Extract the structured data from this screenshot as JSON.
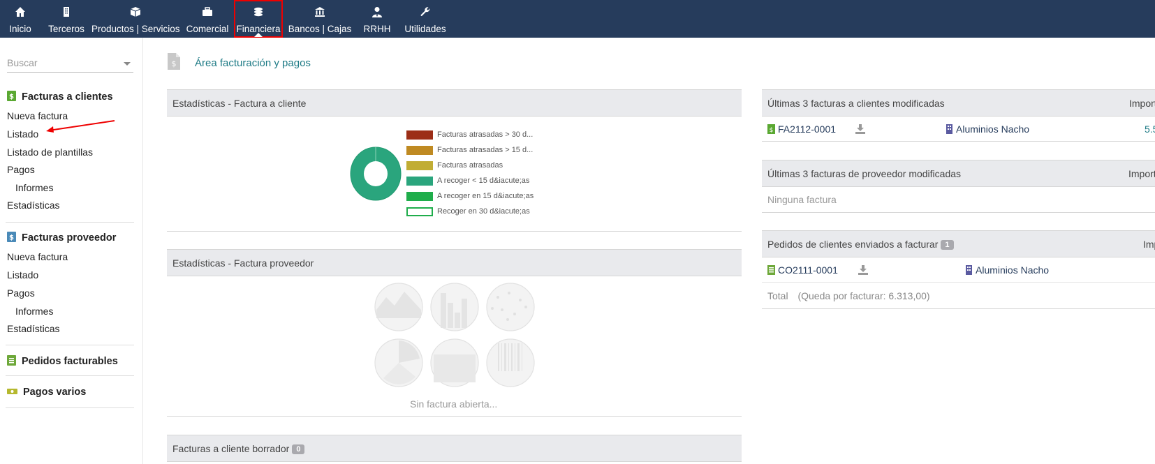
{
  "nav": {
    "items": [
      {
        "label": "Inicio",
        "icon": "home-icon"
      },
      {
        "label": "Terceros",
        "icon": "building-icon"
      },
      {
        "label": "Productos | Servicios",
        "icon": "cube-icon"
      },
      {
        "label": "Comercial",
        "icon": "briefcase-icon"
      },
      {
        "label": "Financiera",
        "icon": "coins-icon",
        "active": true
      },
      {
        "label": "Bancos | Cajas",
        "icon": "bank-icon"
      },
      {
        "label": "RRHH",
        "icon": "user-tie-icon"
      },
      {
        "label": "Utilidades",
        "icon": "wrench-icon"
      }
    ]
  },
  "sidebar": {
    "search_placeholder": "Buscar",
    "sections": [
      {
        "title": "Facturas a clientes",
        "links": [
          "Nueva factura",
          "Listado",
          "Listado de plantillas",
          "Pagos",
          "Informes",
          "Estadísticas"
        ]
      },
      {
        "title": "Facturas proveedor",
        "links": [
          "Nueva factura",
          "Listado",
          "Pagos",
          "Informes",
          "Estadísticas"
        ]
      },
      {
        "title": "Pedidos facturables"
      },
      {
        "title": "Pagos varios"
      }
    ]
  },
  "main": {
    "title": "Área facturación y pagos",
    "stats_customer": {
      "title": "Estadísticas - Factura a cliente",
      "legend": [
        {
          "label": "Facturas atrasadas > 30 d...",
          "color": "#9c2e17"
        },
        {
          "label": "Facturas atrasadas > 15 d...",
          "color": "#bf8a22"
        },
        {
          "label": "Facturas atrasadas",
          "color": "#c1ad34"
        },
        {
          "label": "A recoger < 15 d&iacute;as",
          "color": "#2aa57d"
        },
        {
          "label": "A recoger en 15 d&iacute;as",
          "color": "#1fad4b"
        },
        {
          "label": "Recoger en 30 d&iacute;as",
          "color": "#ffffff"
        }
      ]
    },
    "stats_supplier": {
      "title": "Estadísticas - Factura proveedor",
      "empty_text": "Sin factura abierta..."
    },
    "drafts": {
      "title": "Facturas a cliente borrador",
      "count": "0"
    },
    "last_customer": {
      "title": "Últimas 3 facturas a clientes modificadas",
      "col_amount": "Import",
      "rows": [
        {
          "ref": "FA2112-0001",
          "company": "Aluminios Nacho",
          "amount": "5.5"
        }
      ]
    },
    "last_supplier": {
      "title": "Últimas 3 facturas de proveedor modificadas",
      "col_amount": "Import",
      "empty": "Ninguna factura"
    },
    "orders": {
      "title": "Pedidos de clientes enviados a facturar",
      "count": "1",
      "col_amount": "Imp",
      "rows": [
        {
          "ref": "CO2111-0001",
          "company": "Aluminios Nacho"
        }
      ],
      "total_label": "Total",
      "total_note": "(Queda por facturar: 6.313,00)"
    }
  },
  "colors": {
    "navbar": "#263c5c",
    "accent": "#1d7a85",
    "donut": "#2aa57d",
    "highlight": "#ee0000"
  }
}
